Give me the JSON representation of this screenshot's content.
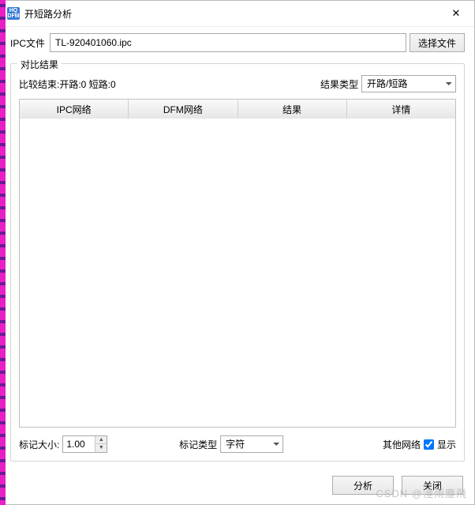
{
  "window": {
    "title": "开短路分析",
    "app_icon_text": "HQ\nDFM"
  },
  "file": {
    "label": "IPC文件",
    "value": "TL-920401060.ipc",
    "choose_btn": "选择文件"
  },
  "group": {
    "title": "对比结果",
    "compare_status": "比较结束:开路:0 短路:0",
    "result_type_label": "结果类型",
    "result_type_value": "开路/短路"
  },
  "table": {
    "columns": [
      "IPC网络",
      "DFM网络",
      "结果",
      "详情"
    ]
  },
  "bottom": {
    "mark_size_label": "标记大小:",
    "mark_size_value": "1.00",
    "mark_type_label": "标记类型",
    "mark_type_value": "字符",
    "other_net_label": "其他网络",
    "show_label": "显示",
    "show_checked": true
  },
  "footer": {
    "analyze": "分析",
    "close": "关闭"
  },
  "watermark": "CSDN @湮雨塵飛"
}
